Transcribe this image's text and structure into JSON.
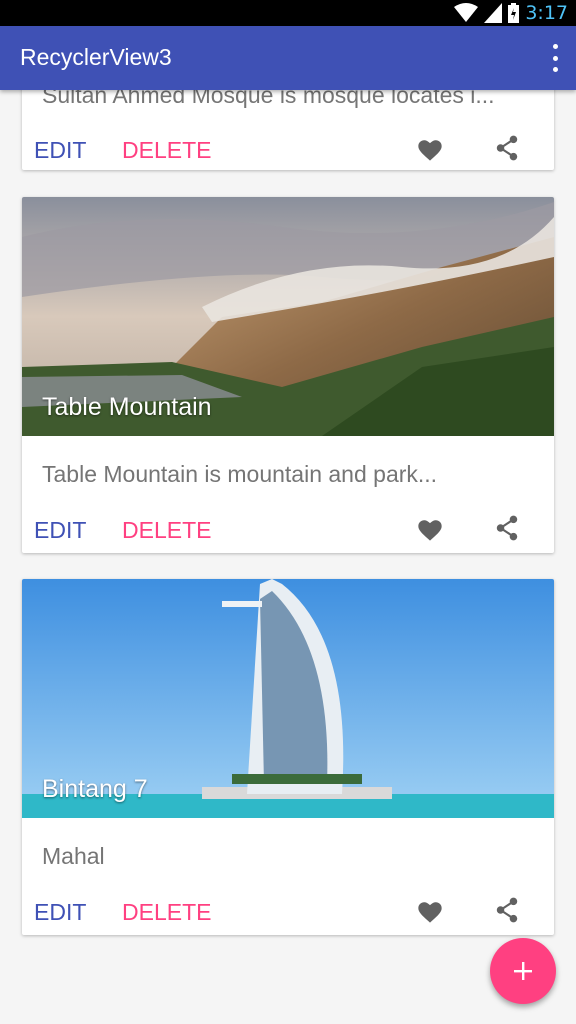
{
  "status_bar": {
    "time": "3:17"
  },
  "app_bar": {
    "title": "RecyclerView3",
    "overflow_icon": "more-vert-icon"
  },
  "cards": [
    {
      "description": "Sultan Ahmed Mosque is mosque locates i...",
      "edit_label": "EDIT",
      "delete_label": "DELETE"
    },
    {
      "title": "Table Mountain",
      "description": "Table Mountain is mountain and park...",
      "edit_label": "EDIT",
      "delete_label": "DELETE"
    },
    {
      "title": "Bintang 7",
      "description": "Mahal",
      "edit_label": "EDIT",
      "delete_label": "DELETE"
    }
  ],
  "fab": {
    "icon": "add-icon"
  },
  "colors": {
    "primary": "#3f51b5",
    "accent": "#ff4081"
  }
}
